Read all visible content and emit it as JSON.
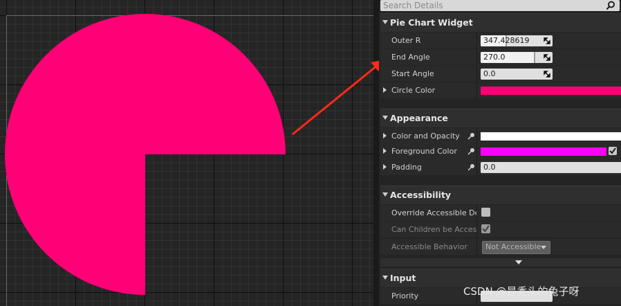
{
  "viewport": {
    "pie": {
      "color": "#ff0077",
      "start_angle": 0.0,
      "end_angle": 270.0
    },
    "annotation_arrow_color": "#ff2a1a"
  },
  "details": {
    "search": {
      "placeholder": "Search Details",
      "icon": "magnifier-icon"
    },
    "sections": [
      {
        "title": "Pie Chart Widget",
        "properties": {
          "outer_r": {
            "label": "Outer R",
            "value": "347.428619"
          },
          "end_angle": {
            "label": "End Angle",
            "value": "270.0"
          },
          "start_angle": {
            "label": "Start Angle",
            "value": "0.0"
          },
          "circle_color": {
            "label": "Circle Color",
            "color": "#ff0077"
          }
        }
      },
      {
        "title": "Appearance",
        "properties": {
          "color_and_opacity": {
            "label": "Color and Opacity",
            "color": "#ffffff"
          },
          "foreground_color": {
            "label": "Foreground Color",
            "color": "#ff00ff"
          },
          "padding": {
            "label": "Padding",
            "value": "0.0"
          }
        }
      },
      {
        "title": "Accessibility",
        "properties": {
          "override_accessible_defaults": {
            "label": "Override Accessible Defa",
            "checked": false
          },
          "can_children_be_accessible": {
            "label": "Can Children be Accessib",
            "checked": true
          },
          "accessible_behavior": {
            "label": "Accessible Behavior",
            "value": "Not Accessible"
          }
        }
      },
      {
        "title": "Input",
        "properties": {
          "priority": {
            "label": "Priority"
          }
        }
      }
    ]
  },
  "watermark": "CSDN @是秃头的兔子呀"
}
